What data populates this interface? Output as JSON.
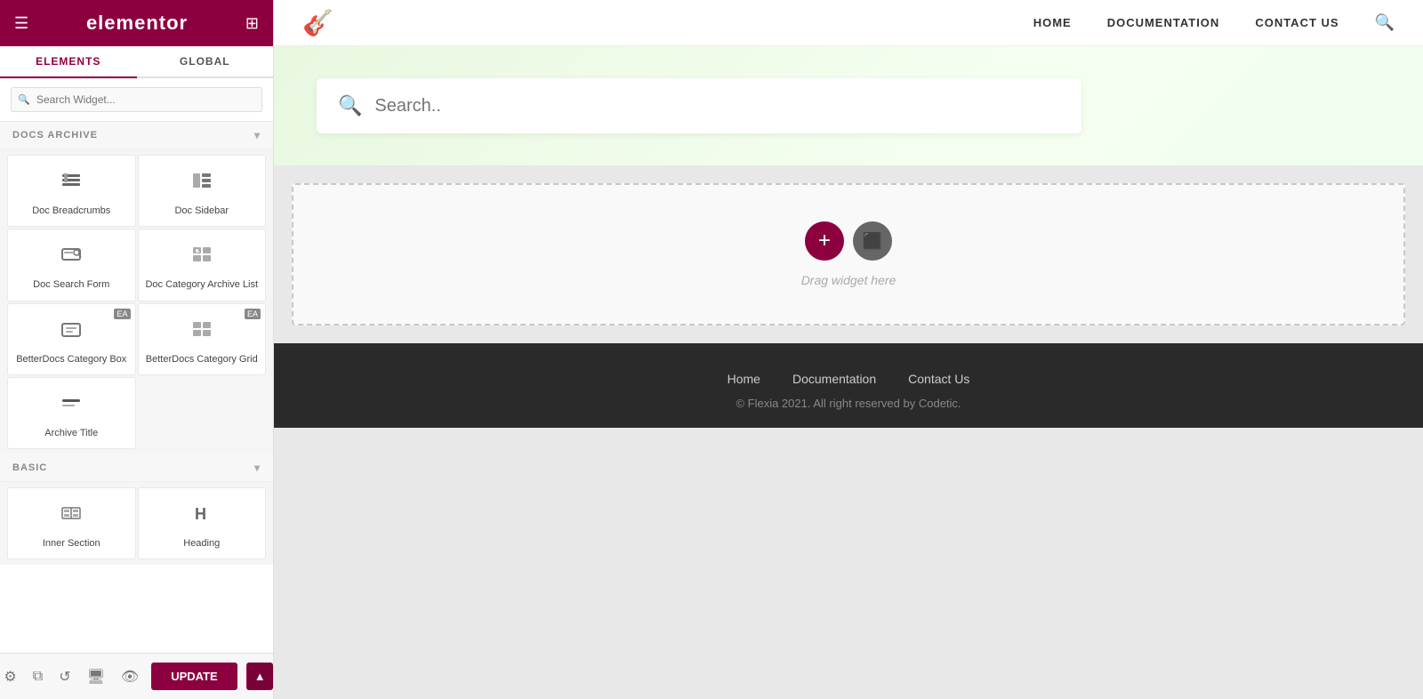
{
  "sidebar": {
    "logo": "elementor",
    "tabs": [
      {
        "id": "elements",
        "label": "ELEMENTS"
      },
      {
        "id": "global",
        "label": "GLOBAL"
      }
    ],
    "active_tab": "elements",
    "search_placeholder": "Search Widget...",
    "sections": [
      {
        "id": "docs-archive",
        "label": "DOCS ARCHIVE",
        "expanded": true,
        "widgets": [
          {
            "id": "doc-breadcrumbs",
            "label": "Doc Breadcrumbs",
            "icon": "grid",
            "badge": null
          },
          {
            "id": "doc-sidebar",
            "label": "Doc Sidebar",
            "icon": "sidebar",
            "badge": null
          },
          {
            "id": "doc-search-form",
            "label": "Doc Search Form",
            "icon": "search-form",
            "badge": null
          },
          {
            "id": "doc-category-archive-list",
            "label": "Doc Category Archive List",
            "icon": "list",
            "badge": null
          },
          {
            "id": "betterdocs-category-box",
            "label": "BetterDocs Category Box",
            "icon": "box",
            "badge": "EA"
          },
          {
            "id": "betterdocs-category-grid",
            "label": "BetterDocs Category Grid",
            "icon": "grid2",
            "badge": "EA"
          },
          {
            "id": "archive-title",
            "label": "Archive Title",
            "icon": "title",
            "badge": null
          }
        ]
      },
      {
        "id": "basic",
        "label": "BASIC",
        "expanded": true,
        "widgets": [
          {
            "id": "inner-section",
            "label": "Inner Section",
            "icon": "inner-section",
            "badge": null
          },
          {
            "id": "heading",
            "label": "Heading",
            "icon": "heading",
            "badge": null
          }
        ]
      }
    ],
    "toolbar": {
      "update_label": "UPDATE"
    }
  },
  "top_nav": {
    "links": [
      "HOME",
      "DOCUMENTATION",
      "CONTACT US"
    ]
  },
  "canvas": {
    "search_placeholder": "Search..",
    "drop_label": "Drag widget here"
  },
  "footer": {
    "links": [
      "Home",
      "Documentation",
      "Contact Us"
    ],
    "copyright": "© Flexia 2021. All right reserved by Codetic."
  }
}
